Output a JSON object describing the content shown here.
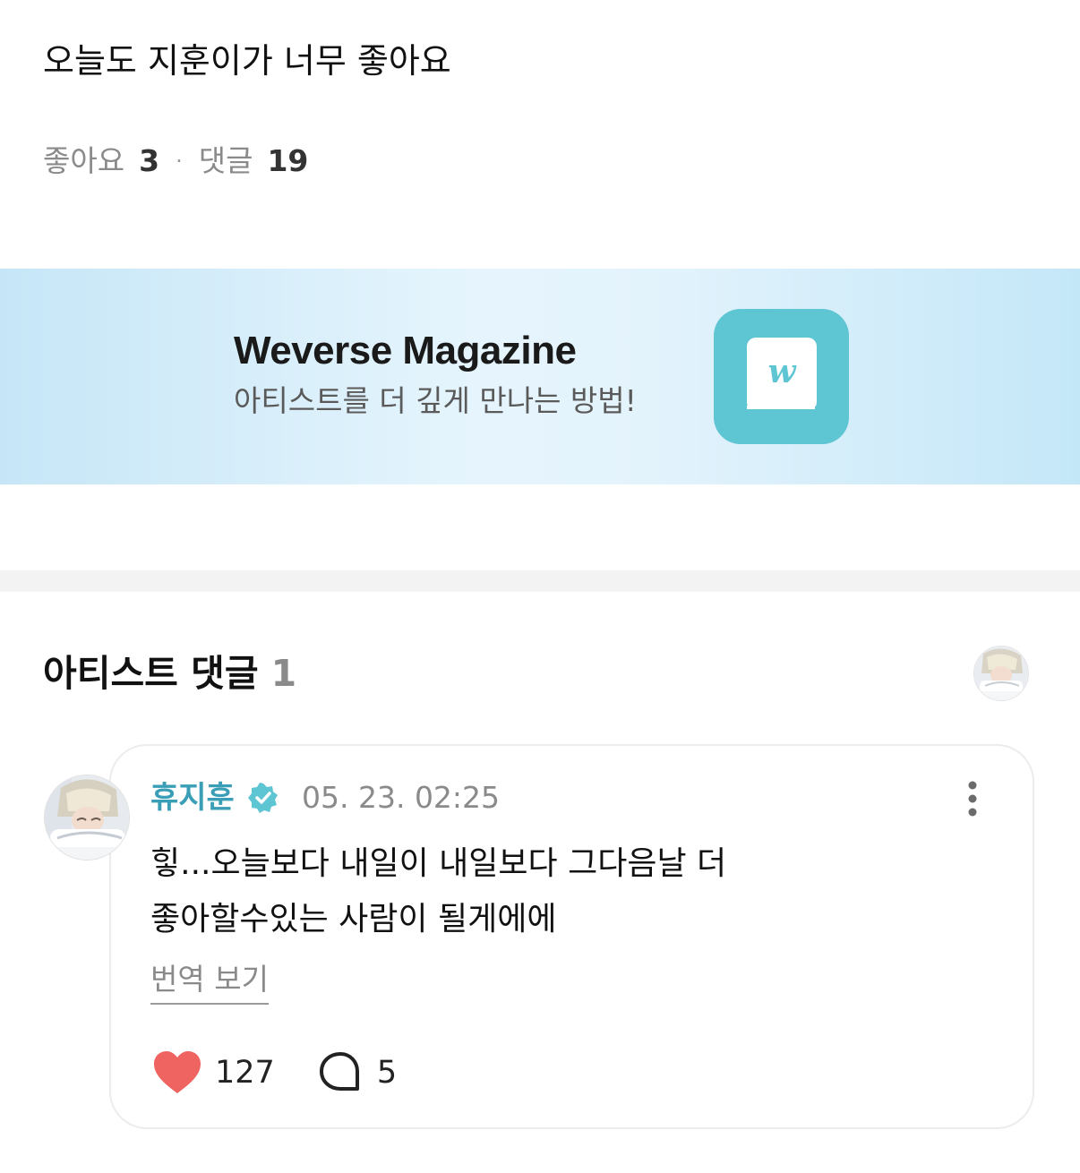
{
  "post": {
    "text": "오늘도 지훈이가 너무 좋아요",
    "likes_label": "좋아요",
    "likes_count": "3",
    "separator": "·",
    "comments_label": "댓글",
    "comments_count": "19"
  },
  "banner": {
    "title": "Weverse Magazine",
    "subtitle": "아티스트를 더 깊게 만나는 방법!",
    "icon": "weverse-magazine-book-icon",
    "icon_letter": "w",
    "accent_color": "#5ec5d3"
  },
  "artist_comments": {
    "title": "아티스트 댓글",
    "count": "1",
    "header_avatar": "artist-avatar-icon"
  },
  "comment": {
    "author": "휴지훈",
    "verified_icon": "verified-badge-icon",
    "timestamp": "05. 23. 02:25",
    "body_lines": [
      "힣...오늘보다 내일이 내일보다 그다음날 더",
      "좋아할수있는 사람이 될게에에"
    ],
    "translate_label": "번역 보기",
    "like_count": "127",
    "reply_count": "5",
    "author_color": "#3a9fb6",
    "like_color": "#ef6461"
  }
}
